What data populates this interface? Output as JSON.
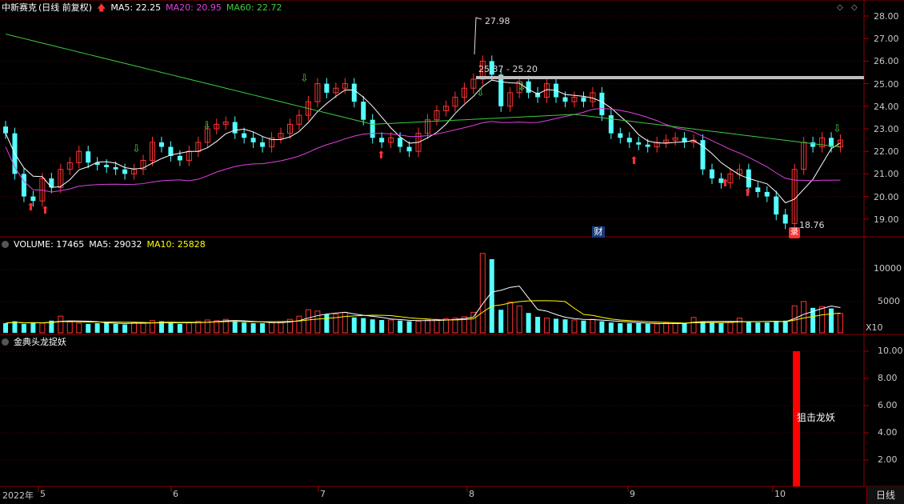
{
  "header": {
    "stock_name": "中新赛克",
    "period_mode": "(日线 前复权)",
    "ma5": "MA5: 22.25",
    "ma20": "MA20: 20.95",
    "ma60": "MA60: 22.72"
  },
  "price_axis": [
    "28.00",
    "27.00",
    "26.00",
    "25.00",
    "24.00",
    "23.00",
    "22.00",
    "21.00",
    "20.00",
    "19.00"
  ],
  "annotations": {
    "high": "27.98",
    "range": "25.37 - 25.20",
    "low": "18.76",
    "cai_badge": "财",
    "jie_badge": "录"
  },
  "volume_panel": {
    "label": "VOLUME: 17465",
    "ma5": "MA5: 29032",
    "ma10": "MA10: 25828",
    "axis": [
      "10000",
      "5000"
    ],
    "unit": "X10"
  },
  "indicator_panel": {
    "label": "金典头龙捉妖",
    "axis": [
      "10.00",
      "8.00",
      "6.00",
      "4.00",
      "2.00"
    ],
    "signal_text": "狙击龙妖",
    "signal_value": 10
  },
  "time_axis": {
    "year": "2022年",
    "months": [
      "5",
      "6",
      "7",
      "8",
      "9",
      "10"
    ]
  },
  "period_button": "日线",
  "colors": {
    "up": "#ff3232",
    "down": "#54ffff",
    "ma5": "#ffffff",
    "ma20": "#e040e0",
    "ma60": "#3ccc3c",
    "vol_ma10": "#ffff00"
  }
}
